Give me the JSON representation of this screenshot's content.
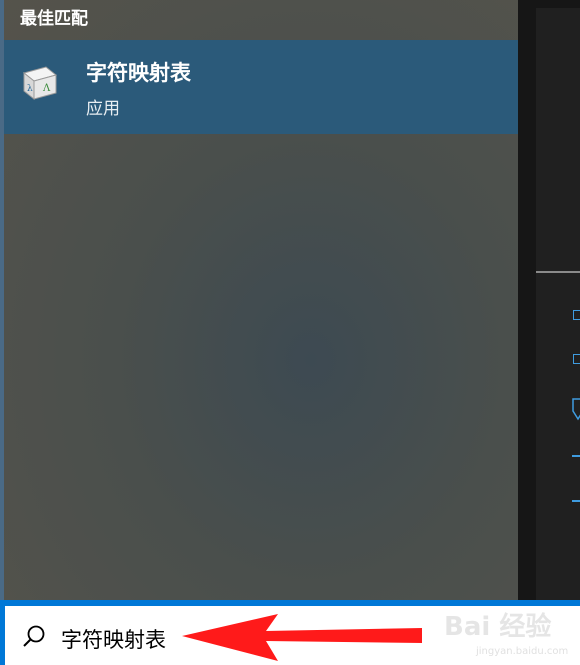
{
  "start_menu": {
    "section_title": "最佳匹配",
    "best_match": {
      "name": "字符映射表",
      "type": "应用",
      "icon": "character-map-icon"
    }
  },
  "search": {
    "icon": "search-icon",
    "query": "字符映射表"
  },
  "annotation": {
    "arrow_color": "#ff1a1a",
    "arrow_icon": "red-arrow-left"
  },
  "watermark": {
    "text": "Bai 经验",
    "sub": "jingyan.baidu.com"
  },
  "colors": {
    "accent": "#0078d7",
    "selected_item": "#2b5a7a",
    "right_glyph": "#3f9ce0"
  }
}
